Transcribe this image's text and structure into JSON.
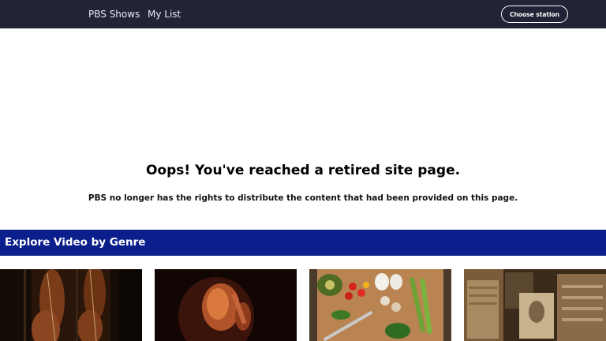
{
  "header": {
    "nav": {
      "shows_label": "PBS Shows",
      "mylist_label": "My List"
    },
    "station_button_label": "Choose station"
  },
  "main": {
    "title": "Oops! You've reached a retired site page.",
    "message": "PBS no longer has the rights to distribute the content that had been provided on this page."
  },
  "genres": {
    "heading": "Explore Video by Genre"
  },
  "colors": {
    "header_bg": "#232337",
    "genre_banner_bg": "#0b1f8c",
    "page_bg": "#ffffff"
  }
}
